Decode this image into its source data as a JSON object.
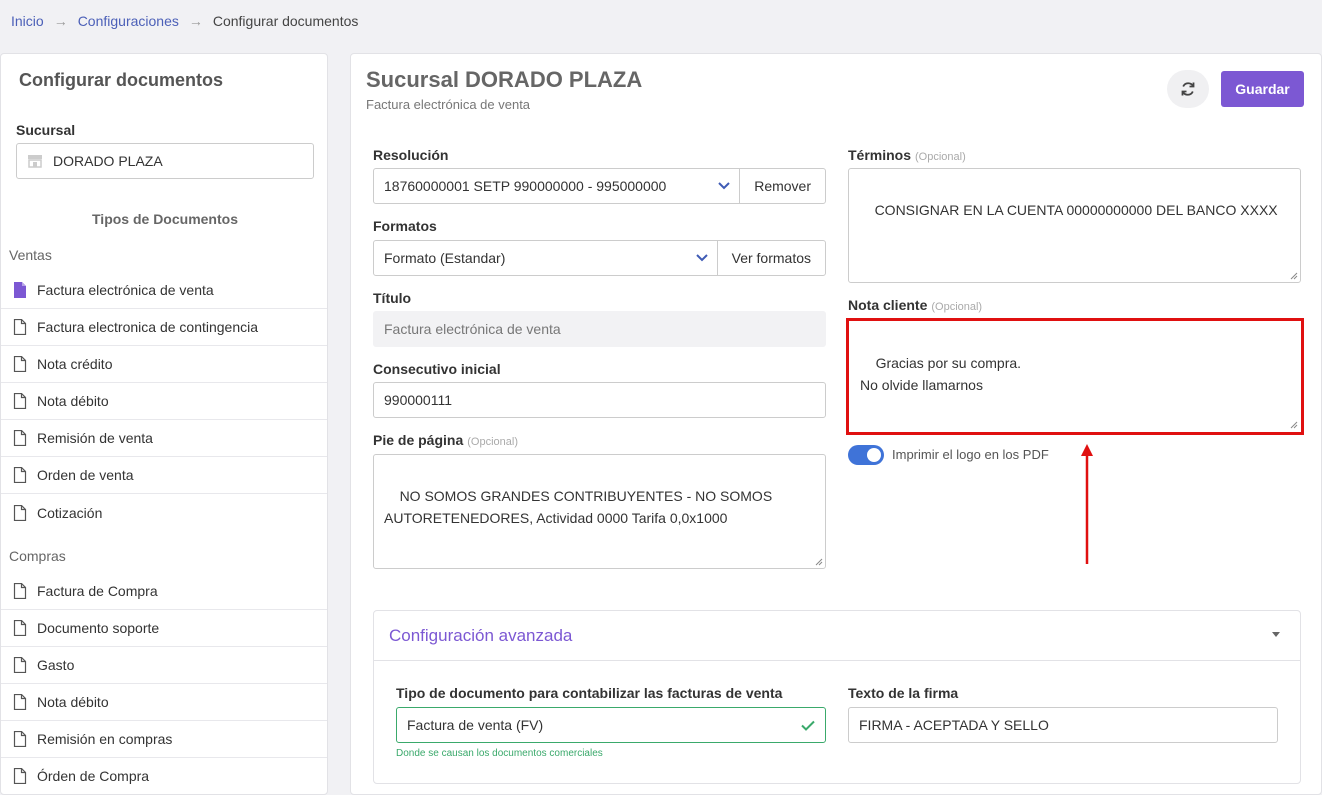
{
  "breadcrumb": {
    "home": "Inicio",
    "settings": "Configuraciones",
    "current": "Configurar documentos",
    "sep": "→"
  },
  "sidebar": {
    "title": "Configurar documentos",
    "branch_label": "Sucursal",
    "branch_value": "DORADO PLAZA",
    "doc_types_title": "Tipos de Documentos",
    "sales_group": "Ventas",
    "sales_items": [
      "Factura electrónica de venta",
      "Factura electronica de contingencia",
      "Nota crédito",
      "Nota débito",
      "Remisión de venta",
      "Orden de venta",
      "Cotización"
    ],
    "purchases_group": "Compras",
    "purchase_items": [
      "Factura de Compra",
      "Documento soporte",
      "Gasto",
      "Nota débito",
      "Remisión en compras",
      "Órden de Compra"
    ]
  },
  "header": {
    "title": "Sucursal DORADO PLAZA",
    "subtitle": "Factura electrónica de venta",
    "save_label": "Guardar"
  },
  "form": {
    "resolution_label": "Resolución",
    "resolution_value": "18760000001 SETP 990000000 - 995000000",
    "remove_label": "Remover",
    "formats_label": "Formatos",
    "formats_value": "Formato (Estandar)",
    "view_formats_label": "Ver formatos",
    "title_label": "Título",
    "title_value": "Factura electrónica de venta",
    "initial_seq_label": "Consecutivo inicial",
    "initial_seq_value": "990000111",
    "footer_label": "Pie de página",
    "optional": "(Opcional)",
    "footer_value": "NO SOMOS GRANDES CONTRIBUYENTES - NO SOMOS AUTORETENEDORES, Actividad 0000 Tarifa 0,0x1000",
    "terms_label": "Términos",
    "terms_value": "CONSIGNAR EN LA CUENTA 00000000000 DEL BANCO XXXX",
    "client_note_label": "Nota cliente",
    "client_note_value": "Gracias por su compra.\nNo olvide llamarnos",
    "print_logo_label": "Imprimir el logo en los PDF",
    "print_logo_on": true
  },
  "advanced": {
    "title": "Configuración avanzada",
    "doc_type_label": "Tipo de documento para contabilizar las facturas de venta",
    "doc_type_value": "Factura de venta (FV)",
    "doc_type_hint": "Donde se causan los documentos comerciales",
    "signature_label": "Texto de la firma",
    "signature_value": "FIRMA - ACEPTADA Y SELLO"
  },
  "colors": {
    "accent": "#7c58d3",
    "link": "#4c60b8",
    "toggle": "#3f73d8",
    "annotation": "#e01010",
    "valid": "#3aa96b"
  }
}
